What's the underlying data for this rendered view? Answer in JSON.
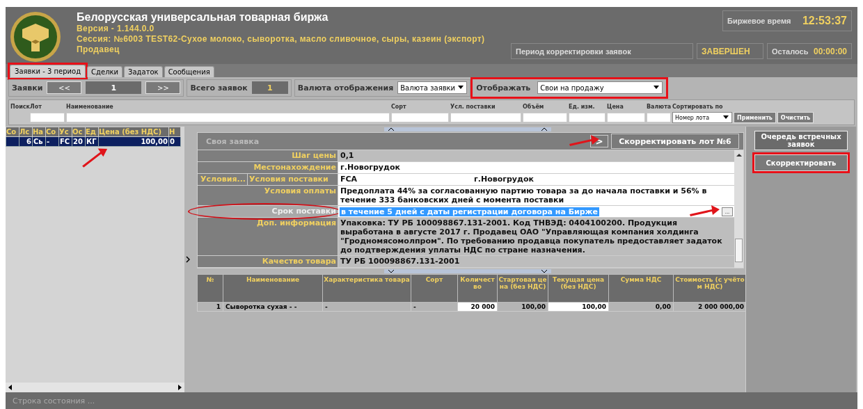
{
  "header": {
    "title": "Белорусская универсальная товарная биржа",
    "version": "Версия - 1.144.0.0",
    "session": "Сессия: №6003 TEST62-Сухое молоко, сыворотка, масло сливочное, сыры, казеин (экспорт)",
    "role": "Продавец",
    "exchange_time": {
      "label": "Биржевое время",
      "value": "12:53:37"
    },
    "period": {
      "label": "Период корректировки заявок",
      "status": "ЗАВЕРШЕН"
    },
    "remaining": {
      "label": "Осталось",
      "value": "00:00:00"
    }
  },
  "tabs": [
    {
      "label": "Заявки - 3 период",
      "selected": true,
      "highlighted": true
    },
    {
      "label": "Сделки",
      "selected": false,
      "highlighted": false
    },
    {
      "label": "Задаток",
      "selected": false,
      "highlighted": false
    },
    {
      "label": "Сообщения",
      "selected": false,
      "highlighted": false
    }
  ],
  "toolbar": {
    "orders_label": "Заявки",
    "prev": "<<",
    "page": "1",
    "next": ">>",
    "total_label": "Всего заявок",
    "total_value": "1",
    "currency_label": "Валюта отображения",
    "currency_value": "Валюта заявки",
    "display_label": "Отображать",
    "display_value": "Свои на продажу",
    "display_highlighted": true
  },
  "search": {
    "title": "Поиск",
    "fields": [
      "Лот",
      "Наименование",
      "Сорт",
      "Усл. поставки",
      "Объём",
      "Ед. изм.",
      "Цена",
      "Валюта"
    ],
    "sort_label": "Сортировать по",
    "sort_value": "Номер лота",
    "apply": "Применить",
    "clear": "Очистить"
  },
  "lots_table": {
    "columns": [
      "Со",
      "Лс",
      "На",
      "Со",
      "Ус",
      "Ос",
      "Ед",
      "Цена (без НДС)",
      "Н"
    ],
    "rows": [
      {
        "cells": [
          "",
          "6",
          "Сь",
          "-",
          "FC",
          "20",
          "КГ",
          "100,00",
          "0"
        ],
        "selected": true,
        "arrow": true
      }
    ]
  },
  "order": {
    "title": "Своя заявка",
    "next_button": ">",
    "next_arrow": true,
    "correct_lot_button": "Скорректировать лот №6",
    "fields": [
      {
        "kind": "single",
        "label": "Шаг цены",
        "value": "0,1",
        "editable": false
      },
      {
        "kind": "single",
        "label": "Местонахождение",
        "value": "г.Новогрудок",
        "editable": true
      },
      {
        "kind": "split",
        "label": "Условия...",
        "label_2": "Условия поставки",
        "value": "FCA",
        "value_2": "г.Новогрудок",
        "editable": true
      },
      {
        "kind": "single",
        "label": "Условия оплаты",
        "value": "Предоплата 44% за согласованную партию товара за  до начала поставки и 56% в течение 333 банковских дней с момента поставки",
        "editable": true
      },
      {
        "kind": "picker",
        "label": "Срок поставки",
        "value": "в течение 5 дней с даты регистрации договора на Бирже",
        "button": "...",
        "editable": true,
        "selected": true,
        "circled": true,
        "arrow": true
      },
      {
        "kind": "single",
        "label": "Доп. информация",
        "value": "Упаковка: ТУ РБ 100098867.131-2001. Код ТНВЭД: 0404100200.       Продукция выработана в августе 2017 г. Продавец ОАО \"Управляющая компания холдинга \"Гродномясомолпром\".  По требованию продавца покупатель предоставляет задаток до подтверждения уплаты НДС по стране назначения.",
        "editable": false
      },
      {
        "kind": "single",
        "label": "Качество товара",
        "value": "ТУ РБ 100098867.131-2001",
        "editable": false
      }
    ]
  },
  "items_table": {
    "columns": [
      {
        "label": "№",
        "editable": false
      },
      {
        "label": "Наименование",
        "editable": false
      },
      {
        "label": "Характеристика товара",
        "editable": false
      },
      {
        "label": "Сорт",
        "editable": false
      },
      {
        "label": "Количество",
        "editable": true
      },
      {
        "label": "Стартовая цена (без НДС)",
        "editable": false
      },
      {
        "label": "Текущая цена (без НДС)",
        "editable": true
      },
      {
        "label": "Сумма НДС",
        "editable": false
      },
      {
        "label": "Стоимость (с учётом НДС)",
        "editable": false
      }
    ],
    "rows": [
      [
        "1",
        "Сыворотка сухая - -",
        "-",
        "-",
        "20 000",
        "100,00",
        "100,00",
        "0,00",
        "2 000 000,00"
      ]
    ]
  },
  "side": {
    "queue_button": "Очередь встречных заявок",
    "correct_button": "Скорректировать",
    "correct_highlighted": true
  },
  "status_bar": {
    "text": "Строка состояния  ..."
  }
}
